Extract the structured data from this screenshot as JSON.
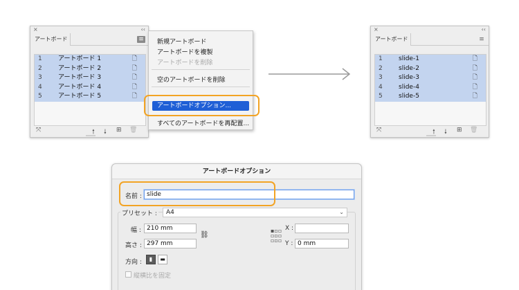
{
  "left_panel": {
    "close_glyph": "×",
    "collapse_glyph": "‹‹",
    "tab_label": "アートボード",
    "menu_glyph": "≡",
    "rows": [
      {
        "num": "1",
        "name": "アートボード 1"
      },
      {
        "num": "2",
        "name": "アートボード 2"
      },
      {
        "num": "3",
        "name": "アートボード 3"
      },
      {
        "num": "4",
        "name": "アートボード 4"
      },
      {
        "num": "5",
        "name": "アートボード 5"
      }
    ]
  },
  "right_panel": {
    "close_glyph": "×",
    "collapse_glyph": "‹‹",
    "tab_label": "アートボード",
    "menu_glyph": "≡",
    "rows": [
      {
        "num": "1",
        "name": "slide-1"
      },
      {
        "num": "2",
        "name": "slide-2"
      },
      {
        "num": "3",
        "name": "slide-3"
      },
      {
        "num": "4",
        "name": "slide-4"
      },
      {
        "num": "5",
        "name": "slide-5"
      }
    ]
  },
  "flyout_menu": {
    "items": [
      {
        "label": "新規アートボード",
        "enabled": true
      },
      {
        "label": "アートボードを複製",
        "enabled": true
      },
      {
        "label": "アートボードを削除",
        "enabled": false
      },
      {
        "label": "空のアートボードを削除",
        "enabled": true
      },
      {
        "label": "アートボードオプション...",
        "enabled": true,
        "highlighted": true
      },
      {
        "label": "すべてのアートボードを再配置...",
        "enabled": true
      }
    ]
  },
  "dialog": {
    "title": "アートボードオプション",
    "name_label": "名前 :",
    "name_value": "slide",
    "preset_label": "プリセット :",
    "preset_value": "A4",
    "width_label": "幅 :",
    "width_value": "210 mm",
    "height_label": "高さ :",
    "height_value": "297 mm",
    "x_label": "X :",
    "x_value": "",
    "y_label": "Y :",
    "y_value": "0 mm",
    "orientation_label": "方向 :",
    "constrain_label": "縦横比を固定"
  },
  "colors": {
    "selection_row": "#c3d4ef",
    "highlight": "#1f5fd6",
    "callout": "#f2a324"
  }
}
